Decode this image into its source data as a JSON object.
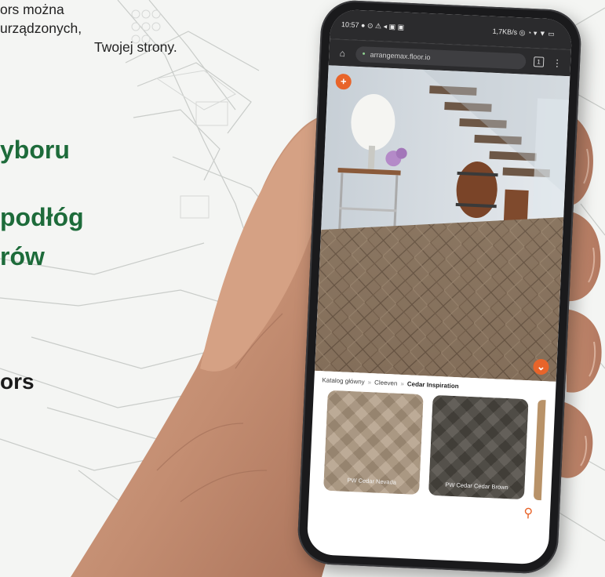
{
  "copy": {
    "line1": "ors można",
    "line2": "urządzonych,",
    "line3": "Twojej strony.",
    "heading1": "yboru",
    "heading2": "podłóg",
    "heading3": "rów",
    "subheading": "ors"
  },
  "phone": {
    "status_left": "10:57 ● ⊙ ⚠ ◂ ▣ ▣",
    "status_right": "1,7KB/s ◎ ◔ ▾ ▼ ▭",
    "url": "arrangemax.floor.io",
    "home_icon": "⌂",
    "lock_icon": "●",
    "tabs_icon": "1",
    "menu_icon": "⋮",
    "fab_top": "+",
    "fab_bottom": "⌄",
    "breadcrumb": {
      "item1": "Katalog główny",
      "sep1": "»",
      "item2": "Cleeven",
      "sep2": "»",
      "item3": "Cedar Inspiration"
    },
    "tile1_caption": "PW Cedar Nevada",
    "tile2_caption": "PW Cedar Cedar Brown",
    "search_icon": "⚲"
  },
  "colors": {
    "brand_green": "#1d6b3a",
    "accent_orange": "#e8642a"
  }
}
